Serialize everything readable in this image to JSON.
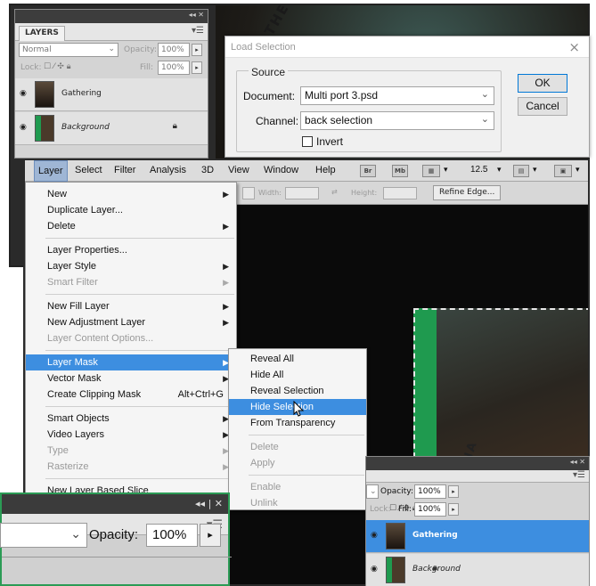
{
  "layers_panel": {
    "tab": "LAYERS",
    "blend_mode": "Normal",
    "opacity_label": "Opacity:",
    "opacity_value": "100%",
    "lock_label": "Lock:",
    "fill_label": "Fill:",
    "fill_value": "100%",
    "layers": [
      {
        "name": "Gathering",
        "selected": false,
        "locked": false
      },
      {
        "name": "Background",
        "selected": false,
        "locked": true
      }
    ]
  },
  "church_text": [
    "LE THE",
    "KE NNA"
  ],
  "dialog": {
    "title": "Load Selection",
    "close_glyph": "×",
    "group_label": "Source",
    "document_label": "Document:",
    "document_value": "Multi port 3.psd",
    "channel_label": "Channel:",
    "channel_value": "back selection",
    "invert_label": "Invert",
    "invert_checked": false,
    "ok_label": "OK",
    "cancel_label": "Cancel"
  },
  "menubar": {
    "items": [
      "Layer",
      "Select",
      "Filter",
      "Analysis",
      "3D",
      "View",
      "Window",
      "Help"
    ],
    "active": "Layer",
    "icons": [
      "Br",
      "Mb"
    ],
    "zoom": "12.5"
  },
  "options_bar": {
    "width_label": "Width:",
    "height_label": "Height:",
    "refine_label": "Refine Edge..."
  },
  "layer_menu": [
    {
      "label": "New",
      "submenu": true
    },
    {
      "label": "Duplicate Layer..."
    },
    {
      "label": "Delete",
      "submenu": true
    },
    {
      "sep": true
    },
    {
      "label": "Layer Properties..."
    },
    {
      "label": "Layer Style",
      "submenu": true
    },
    {
      "label": "Smart Filter",
      "submenu": true,
      "disabled": true
    },
    {
      "sep": true
    },
    {
      "label": "New Fill Layer",
      "submenu": true
    },
    {
      "label": "New Adjustment Layer",
      "submenu": true
    },
    {
      "label": "Layer Content Options...",
      "disabled": true
    },
    {
      "sep": true
    },
    {
      "label": "Layer Mask",
      "submenu": true,
      "highlighted": true
    },
    {
      "label": "Vector Mask",
      "submenu": true
    },
    {
      "label": "Create Clipping Mask",
      "shortcut": "Alt+Ctrl+G"
    },
    {
      "sep": true
    },
    {
      "label": "Smart Objects",
      "submenu": true
    },
    {
      "label": "Video Layers",
      "submenu": true
    },
    {
      "label": "Type",
      "submenu": true,
      "disabled": true
    },
    {
      "label": "Rasterize",
      "submenu": true,
      "disabled": true
    },
    {
      "sep": true
    },
    {
      "label": "New Layer Based Slice"
    }
  ],
  "mask_submenu": [
    {
      "label": "Reveal All"
    },
    {
      "label": "Hide All"
    },
    {
      "label": "Reveal Selection"
    },
    {
      "label": "Hide Selection",
      "highlighted": true
    },
    {
      "label": "From Transparency"
    },
    {
      "sep": true
    },
    {
      "label": "Delete",
      "disabled": true
    },
    {
      "label": "Apply",
      "disabled": true
    },
    {
      "sep": true
    },
    {
      "label": "Enable",
      "disabled": true
    },
    {
      "label": "Unlink",
      "disabled": true
    }
  ],
  "layers_panel_2": {
    "opacity_label": "Opacity:",
    "opacity_value": "100%",
    "lock_label": "Lock:",
    "fill_label": "Fill:",
    "fill_value": "100%",
    "layers": [
      {
        "name": "Gathering",
        "selected": true
      },
      {
        "name": "Background",
        "locked": true
      }
    ]
  },
  "zoom_panel": {
    "opacity_label": "Opacity:",
    "opacity_value": "100%"
  },
  "colors": {
    "menu_highlight": "#3d8ee0",
    "menubar_active": "#9fb6d5",
    "layer_selected": "#3d8ee0",
    "green_screen": "#1f9a4f"
  }
}
